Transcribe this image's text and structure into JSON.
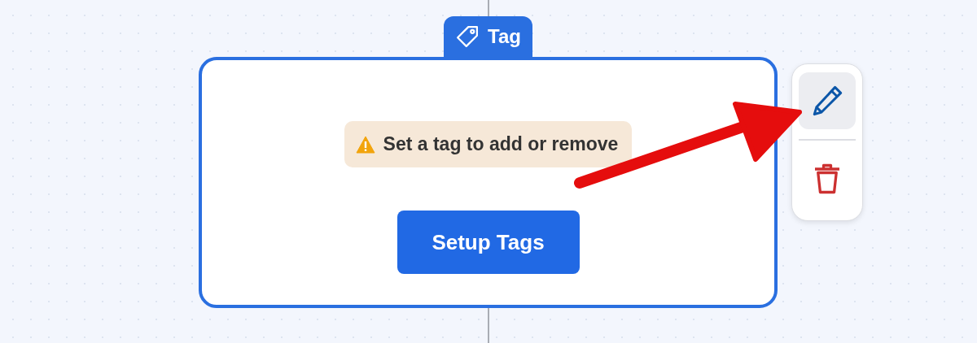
{
  "node": {
    "tab": {
      "label": "Tag"
    },
    "warning": {
      "text": "Set a tag to add or remove"
    },
    "button": {
      "label": "Setup Tags"
    }
  },
  "toolbar": [
    {
      "kind": "edit",
      "selected": true
    },
    {
      "kind": "delete",
      "selected": false
    }
  ]
}
